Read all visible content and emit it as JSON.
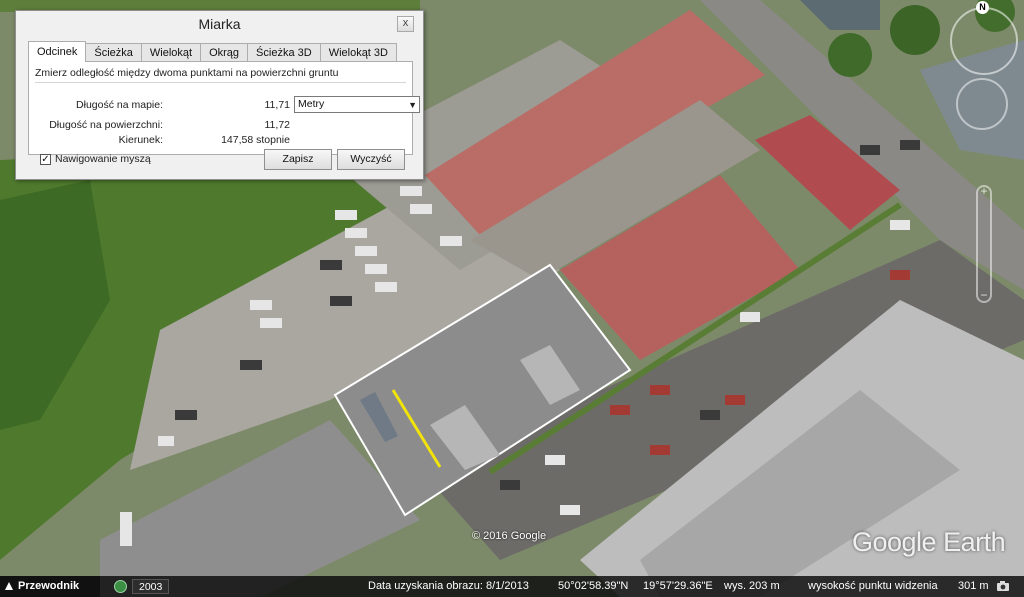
{
  "dialog": {
    "title": "Miarka",
    "close_glyph": "x",
    "tabs": [
      {
        "label": "Odcinek",
        "active": true
      },
      {
        "label": "Ścieżka",
        "active": false
      },
      {
        "label": "Wielokąt",
        "active": false
      },
      {
        "label": "Okrąg",
        "active": false
      },
      {
        "label": "Ścieżka 3D",
        "active": false
      },
      {
        "label": "Wielokąt 3D",
        "active": false
      }
    ],
    "description": "Zmierz odległość między dwoma punktami na powierzchni gruntu",
    "map_length_label": "Długość na mapie:",
    "map_length_value": "11,71",
    "units_selected": "Metry",
    "surface_length_label": "Długość na powierzchni:",
    "surface_length_value": "11,72",
    "heading_label": "Kierunek:",
    "heading_value": "147,58 stopnie",
    "mouse_nav_label": "Nawigowanie myszą",
    "mouse_nav_checked": true,
    "save_label": "Zapisz",
    "clear_label": "Wyczyść"
  },
  "map": {
    "copyright": "© 2016 Google",
    "logo": "Google Earth",
    "compass_north": "N",
    "measure_line_color": "#f2e40a",
    "selection_color": "#ffffff"
  },
  "statusbar": {
    "guide_label": "Przewodnik",
    "year": "2003",
    "imagery_date": "Data uzyskania obrazu: 8/1/2013",
    "latitude": "50°02'58.39\"N",
    "longitude": "19°57'29.36\"E",
    "elevation": "wys.  203 m",
    "eye_altitude_label": "wysokość punktu widzenia",
    "eye_altitude": "301 m"
  }
}
